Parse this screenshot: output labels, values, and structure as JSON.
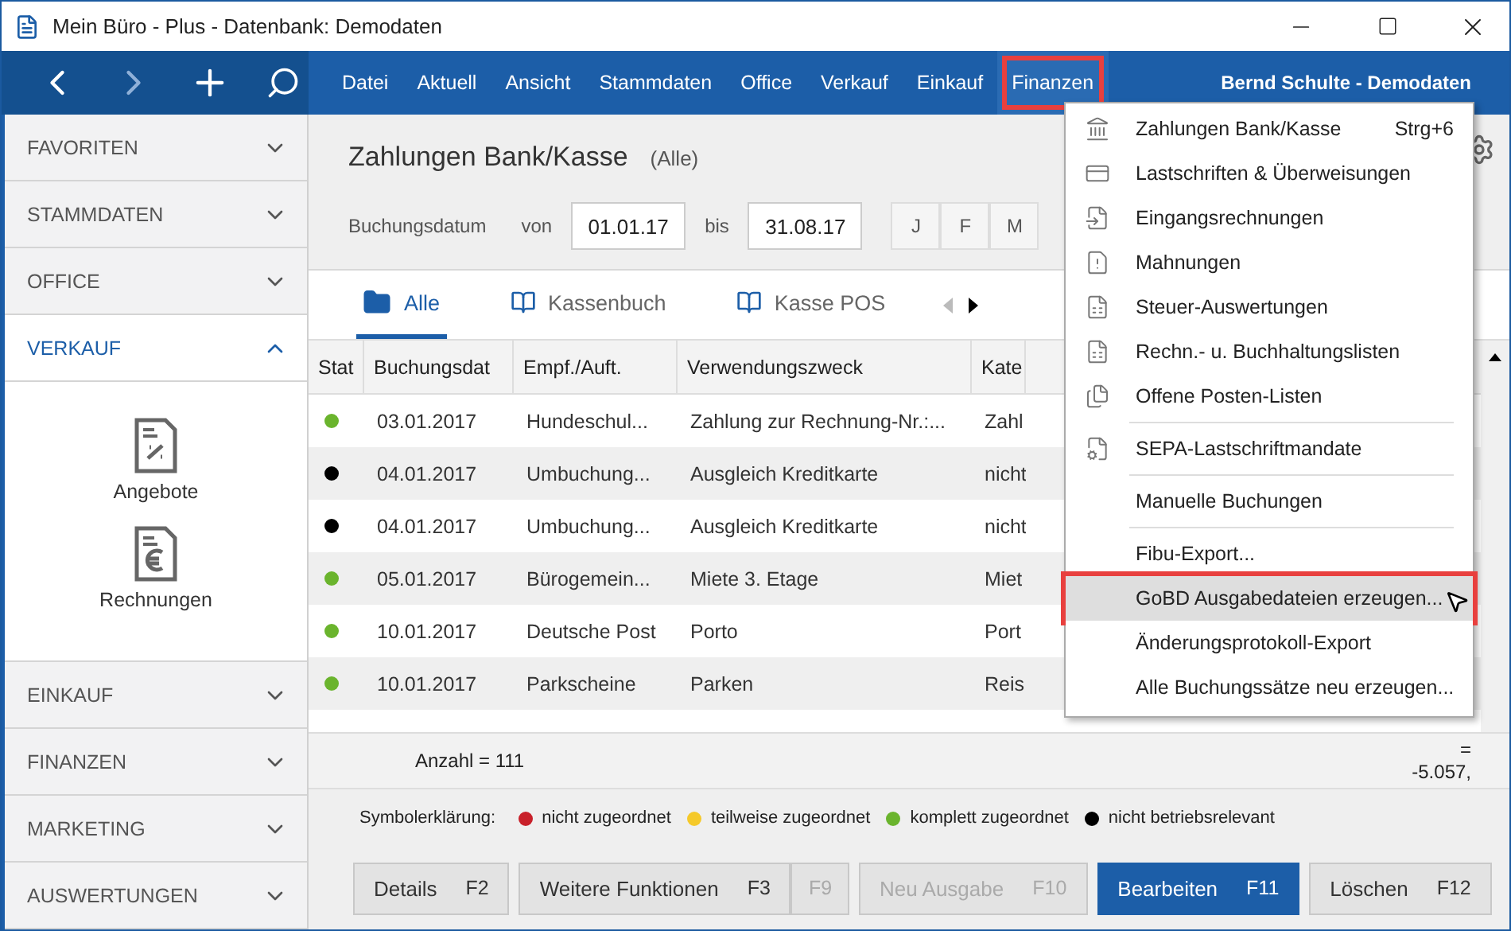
{
  "window": {
    "title": "Mein Büro - Plus - Datenbank: Demodaten"
  },
  "menubar": {
    "items": [
      {
        "label": "Datei",
        "selected": false
      },
      {
        "label": "Aktuell",
        "selected": false
      },
      {
        "label": "Ansicht",
        "selected": false
      },
      {
        "label": "Stammdaten",
        "selected": false
      },
      {
        "label": "Office",
        "selected": false
      },
      {
        "label": "Verkauf",
        "selected": false
      },
      {
        "label": "Einkauf",
        "selected": false
      },
      {
        "label": "Finanzen",
        "selected": true
      }
    ],
    "user": "Bernd Schulte - Demodaten"
  },
  "sidebar": {
    "sections": [
      {
        "label": "FAVORITEN",
        "expanded": false
      },
      {
        "label": "STAMMDATEN",
        "expanded": false
      },
      {
        "label": "OFFICE",
        "expanded": false
      },
      {
        "label": "VERKAUF",
        "expanded": true,
        "items": [
          "Angebote",
          "Rechnungen"
        ]
      },
      {
        "label": "EINKAUF",
        "expanded": false
      },
      {
        "label": "FINANZEN",
        "expanded": false
      },
      {
        "label": "MARKETING",
        "expanded": false
      },
      {
        "label": "AUSWERTUNGEN",
        "expanded": false
      }
    ]
  },
  "header": {
    "title": "Zahlungen Bank/Kasse",
    "subtitle": "(Alle)",
    "filter_label": "Buchungsdatum",
    "from_label": "von",
    "from": "01.01.17",
    "to_label": "bis",
    "to": "31.08.17",
    "months": [
      "J",
      "F",
      "M"
    ]
  },
  "tabs": [
    {
      "label": "Alle",
      "selected": true
    },
    {
      "label": "Kassenbuch",
      "selected": false
    },
    {
      "label": "Kasse POS",
      "selected": false
    }
  ],
  "table": {
    "columns": [
      "Stat",
      "Buchungsdat",
      "Empf./Auft.",
      "Verwendungszweck",
      "Kate"
    ],
    "rows": [
      {
        "color": "#6ab42d",
        "date": "03.01.2017",
        "party": "Hundeschul...",
        "purpose": "Zahlung zur Rechnung-Nr.:...",
        "category": "Zahl"
      },
      {
        "color": "#000000",
        "date": "04.01.2017",
        "party": "Umbuchung...",
        "purpose": "Ausgleich Kreditkarte",
        "category": "nicht"
      },
      {
        "color": "#000000",
        "date": "04.01.2017",
        "party": "Umbuchung...",
        "purpose": "Ausgleich Kreditkarte",
        "category": "nicht"
      },
      {
        "color": "#6ab42d",
        "date": "05.01.2017",
        "party": "Bürogemein...",
        "purpose": "Miete 3. Etage",
        "category": "Miet"
      },
      {
        "color": "#6ab42d",
        "date": "10.01.2017",
        "party": "Deutsche Post",
        "purpose": "Porto",
        "category": "Port"
      },
      {
        "color": "#6ab42d",
        "date": "10.01.2017",
        "party": "Parkscheine",
        "purpose": "Parken",
        "category": "Reis"
      }
    ],
    "count": "Anzahl = 111",
    "total_sign": "=",
    "total": "-5.057,"
  },
  "legend": {
    "label": "Symbolerklärung:",
    "items": [
      {
        "label": "nicht zugeordnet",
        "color": "#c8202a"
      },
      {
        "label": "teilweise zugeordnet",
        "color": "#f5c92a"
      },
      {
        "label": "komplett zugeordnet",
        "color": "#6ab42d"
      },
      {
        "label": "nicht betriebsrelevant",
        "color": "#000000"
      }
    ]
  },
  "buttons": [
    {
      "label": "Details",
      "key": "F2",
      "kind": "normal",
      "disabled": false
    },
    {
      "label": "Weitere Funktionen",
      "key": "F3",
      "kind": "normal",
      "disabled": false
    },
    {
      "key": "F9",
      "kind": "key",
      "disabled": true
    },
    {
      "label": "Neu Ausgabe",
      "key": "F10",
      "kind": "normal",
      "disabled": true
    },
    {
      "label": "Bearbeiten",
      "key": "F11",
      "kind": "primary",
      "disabled": false
    },
    {
      "label": "Löschen",
      "key": "F12",
      "kind": "normal",
      "disabled": false
    }
  ],
  "dropdown": {
    "items": [
      {
        "kind": "item",
        "label": "Zahlungen Bank/Kasse",
        "shortcut": "Strg+6",
        "selected": false
      },
      {
        "kind": "item",
        "label": "Lastschriften & Überweisungen",
        "selected": false
      },
      {
        "kind": "item",
        "label": "Eingangsrechnungen",
        "selected": false
      },
      {
        "kind": "item",
        "label": "Mahnungen",
        "selected": false
      },
      {
        "kind": "item",
        "label": "Steuer-Auswertungen",
        "selected": false
      },
      {
        "kind": "item",
        "label": "Rechn.- u. Buchhaltungslisten",
        "selected": false
      },
      {
        "kind": "item",
        "label": "Offene Posten-Listen",
        "selected": false
      },
      {
        "kind": "separator"
      },
      {
        "kind": "item",
        "label": "SEPA-Lastschriftmandate",
        "selected": false
      },
      {
        "kind": "separator"
      },
      {
        "kind": "item",
        "label": "Manuelle Buchungen",
        "selected": false
      },
      {
        "kind": "separator"
      },
      {
        "kind": "item",
        "label": "Fibu-Export...",
        "selected": false
      },
      {
        "kind": "item",
        "label": "GoBD Ausgabedateien erzeugen...",
        "selected": true
      },
      {
        "kind": "item",
        "label": "Änderungsprotokoll-Export",
        "selected": false
      },
      {
        "kind": "item",
        "label": "Alle Buchungssätze neu erzeugen...",
        "selected": false
      }
    ]
  }
}
